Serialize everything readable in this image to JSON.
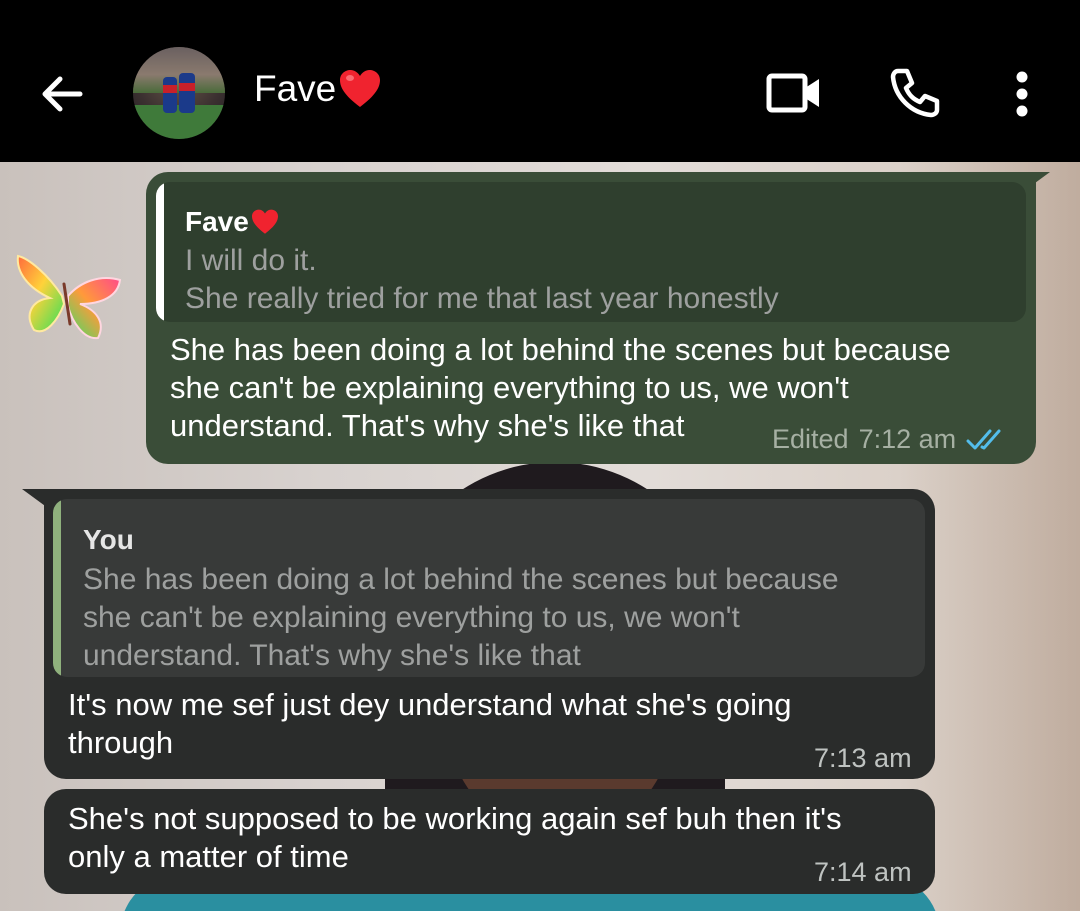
{
  "header": {
    "contact_name": "Fave",
    "icons": [
      "back-arrow-icon",
      "avatar",
      "heart-emoji",
      "video-call-icon",
      "phone-icon",
      "more-vert-icon"
    ]
  },
  "colors": {
    "header_bg": "#000000",
    "outgoing_bubble": "#3a4d38",
    "incoming_bubble": "#2a2c2b",
    "read_ticks": "#53bdeb",
    "quote_bar_out": "#ffffff",
    "quote_bar_in": "#8fb17d"
  },
  "messages": [
    {
      "direction": "outgoing",
      "quote": {
        "author": "Fave",
        "lines": [
          "I will do it.",
          "She really tried for me that last year honestly"
        ]
      },
      "lines": [
        "She has been doing a lot behind the scenes but because",
        "she can't be explaining everything to us, we won't",
        "understand. That's why she's like that"
      ],
      "status": "Edited",
      "time": "7:12 am",
      "ticks": "read"
    },
    {
      "direction": "incoming",
      "quote": {
        "author": "You",
        "lines": [
          "She has been doing a lot behind the scenes but because",
          "she can't be explaining everything to us, we won't",
          "understand. That's why she's like that"
        ]
      },
      "lines": [
        "It's now me sef just dey understand what she's going",
        "through"
      ],
      "time": "7:13 am"
    },
    {
      "direction": "incoming",
      "lines": [
        "She's not supposed to be working again sef buh then it's",
        "only a matter of time"
      ],
      "time": "7:14 am"
    }
  ]
}
